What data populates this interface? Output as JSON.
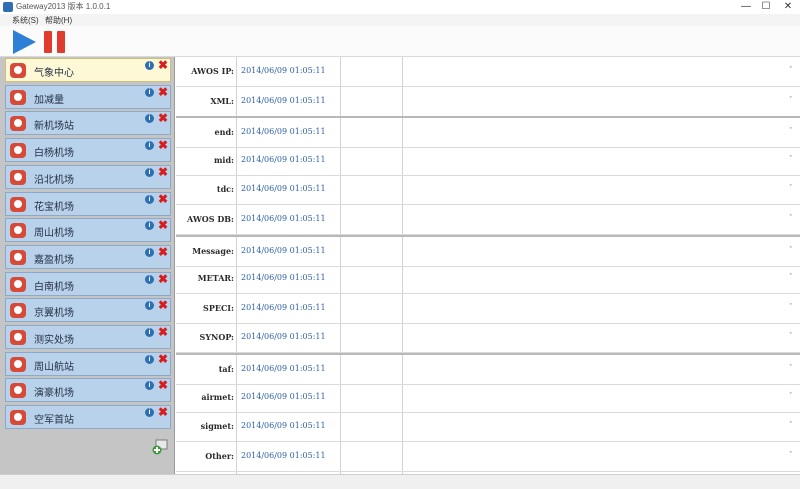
{
  "window": {
    "title": "Gateway2013 版本 1.0.0.1",
    "controls": {
      "minimize": "—",
      "maximize": "☐",
      "close": "✕"
    }
  },
  "menu": {
    "items": [
      "系统(S)",
      "帮助(H)"
    ]
  },
  "toolbar": {
    "play_icon": "play-icon",
    "pause_icon": "pause-icon",
    "play_color": "#2e7fd6",
    "pause_color": "#e03b2c"
  },
  "sidebar": {
    "items": [
      {
        "label": "气象中心",
        "active": true
      },
      {
        "label": "加减量",
        "active": false
      },
      {
        "label": "新机场站",
        "active": false
      },
      {
        "label": "白杨机场",
        "active": false
      },
      {
        "label": "沿北机场",
        "active": false
      },
      {
        "label": "花宝机场",
        "active": false
      },
      {
        "label": "周山机场",
        "active": false
      },
      {
        "label": "嘉盈机场",
        "active": false
      },
      {
        "label": "白南机场",
        "active": false
      },
      {
        "label": "京翼机场",
        "active": false
      },
      {
        "label": "测实处场",
        "active": false
      },
      {
        "label": "周山航站",
        "active": false
      },
      {
        "label": "演豪机场",
        "active": false
      },
      {
        "label": "空军首站",
        "active": false
      }
    ]
  },
  "grid": {
    "rows": [
      {
        "label": "AWOS IP:",
        "time": "2014/06/09 01:05:11"
      },
      {
        "label": "XML:",
        "time": "2014/06/09 01:05:11"
      },
      {
        "label": "end:",
        "time": "2014/06/09 01:05:11"
      },
      {
        "label": "mid:",
        "time": "2014/06/09 01:05:11"
      },
      {
        "label": "tdc:",
        "time": "2014/06/09 01:05:11"
      },
      {
        "label": "AWOS DB:",
        "time": "2014/06/09 01:05:11"
      },
      {
        "label": "Message:",
        "time": "2014/06/09 01:05:11"
      },
      {
        "label": "METAR:",
        "time": "2014/06/09 01:05:11"
      },
      {
        "label": "SPECI:",
        "time": "2014/06/09 01:05:11"
      },
      {
        "label": "SYNOP:",
        "time": "2014/06/09 01:05:11"
      },
      {
        "label": "taf:",
        "time": "2014/06/09 01:05:11"
      },
      {
        "label": "airmet:",
        "time": "2014/06/09 01:05:11"
      },
      {
        "label": "sigmet:",
        "time": "2014/06/09 01:05:11"
      },
      {
        "label": "Other:",
        "time": "2014/06/09 01:05:11"
      }
    ]
  }
}
